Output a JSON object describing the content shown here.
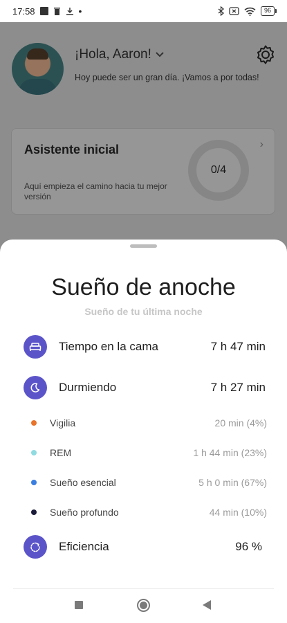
{
  "status_bar": {
    "time": "17:58",
    "battery": "96"
  },
  "header": {
    "greeting": "¡Hola, Aaron!",
    "subtitle": "Hoy puede ser un gran día. ¡Vamos a por todas!"
  },
  "card": {
    "title": "Asistente inicial",
    "description": "Aquí empieza el camino hacia tu mejor versión",
    "progress": "0/4"
  },
  "sheet": {
    "title": "Sueño de anoche",
    "subtitle": "Sueño de tu última noche",
    "time_in_bed": {
      "label": "Tiempo en la cama",
      "value": "7 h 47 min",
      "icon": "bed-icon"
    },
    "sleeping": {
      "label": "Durmiendo",
      "value": "7 h 27 min",
      "icon": "moon-icon"
    },
    "stages": [
      {
        "label": "Vigilia",
        "value": "20 min (4%)",
        "color": "#e8742c"
      },
      {
        "label": "REM",
        "value": "1 h 44 min (23%)",
        "color": "#8fdbe0"
      },
      {
        "label": "Sueño esencial",
        "value": "5 h 0 min (67%)",
        "color": "#3a7ee0"
      },
      {
        "label": "Sueño profundo",
        "value": "44 min (10%)",
        "color": "#1b1b3a"
      }
    ],
    "efficiency": {
      "label": "Eficiencia",
      "value": "96 %",
      "icon": "efficiency-icon"
    }
  },
  "colors": {
    "accent": "#5b54c9"
  }
}
